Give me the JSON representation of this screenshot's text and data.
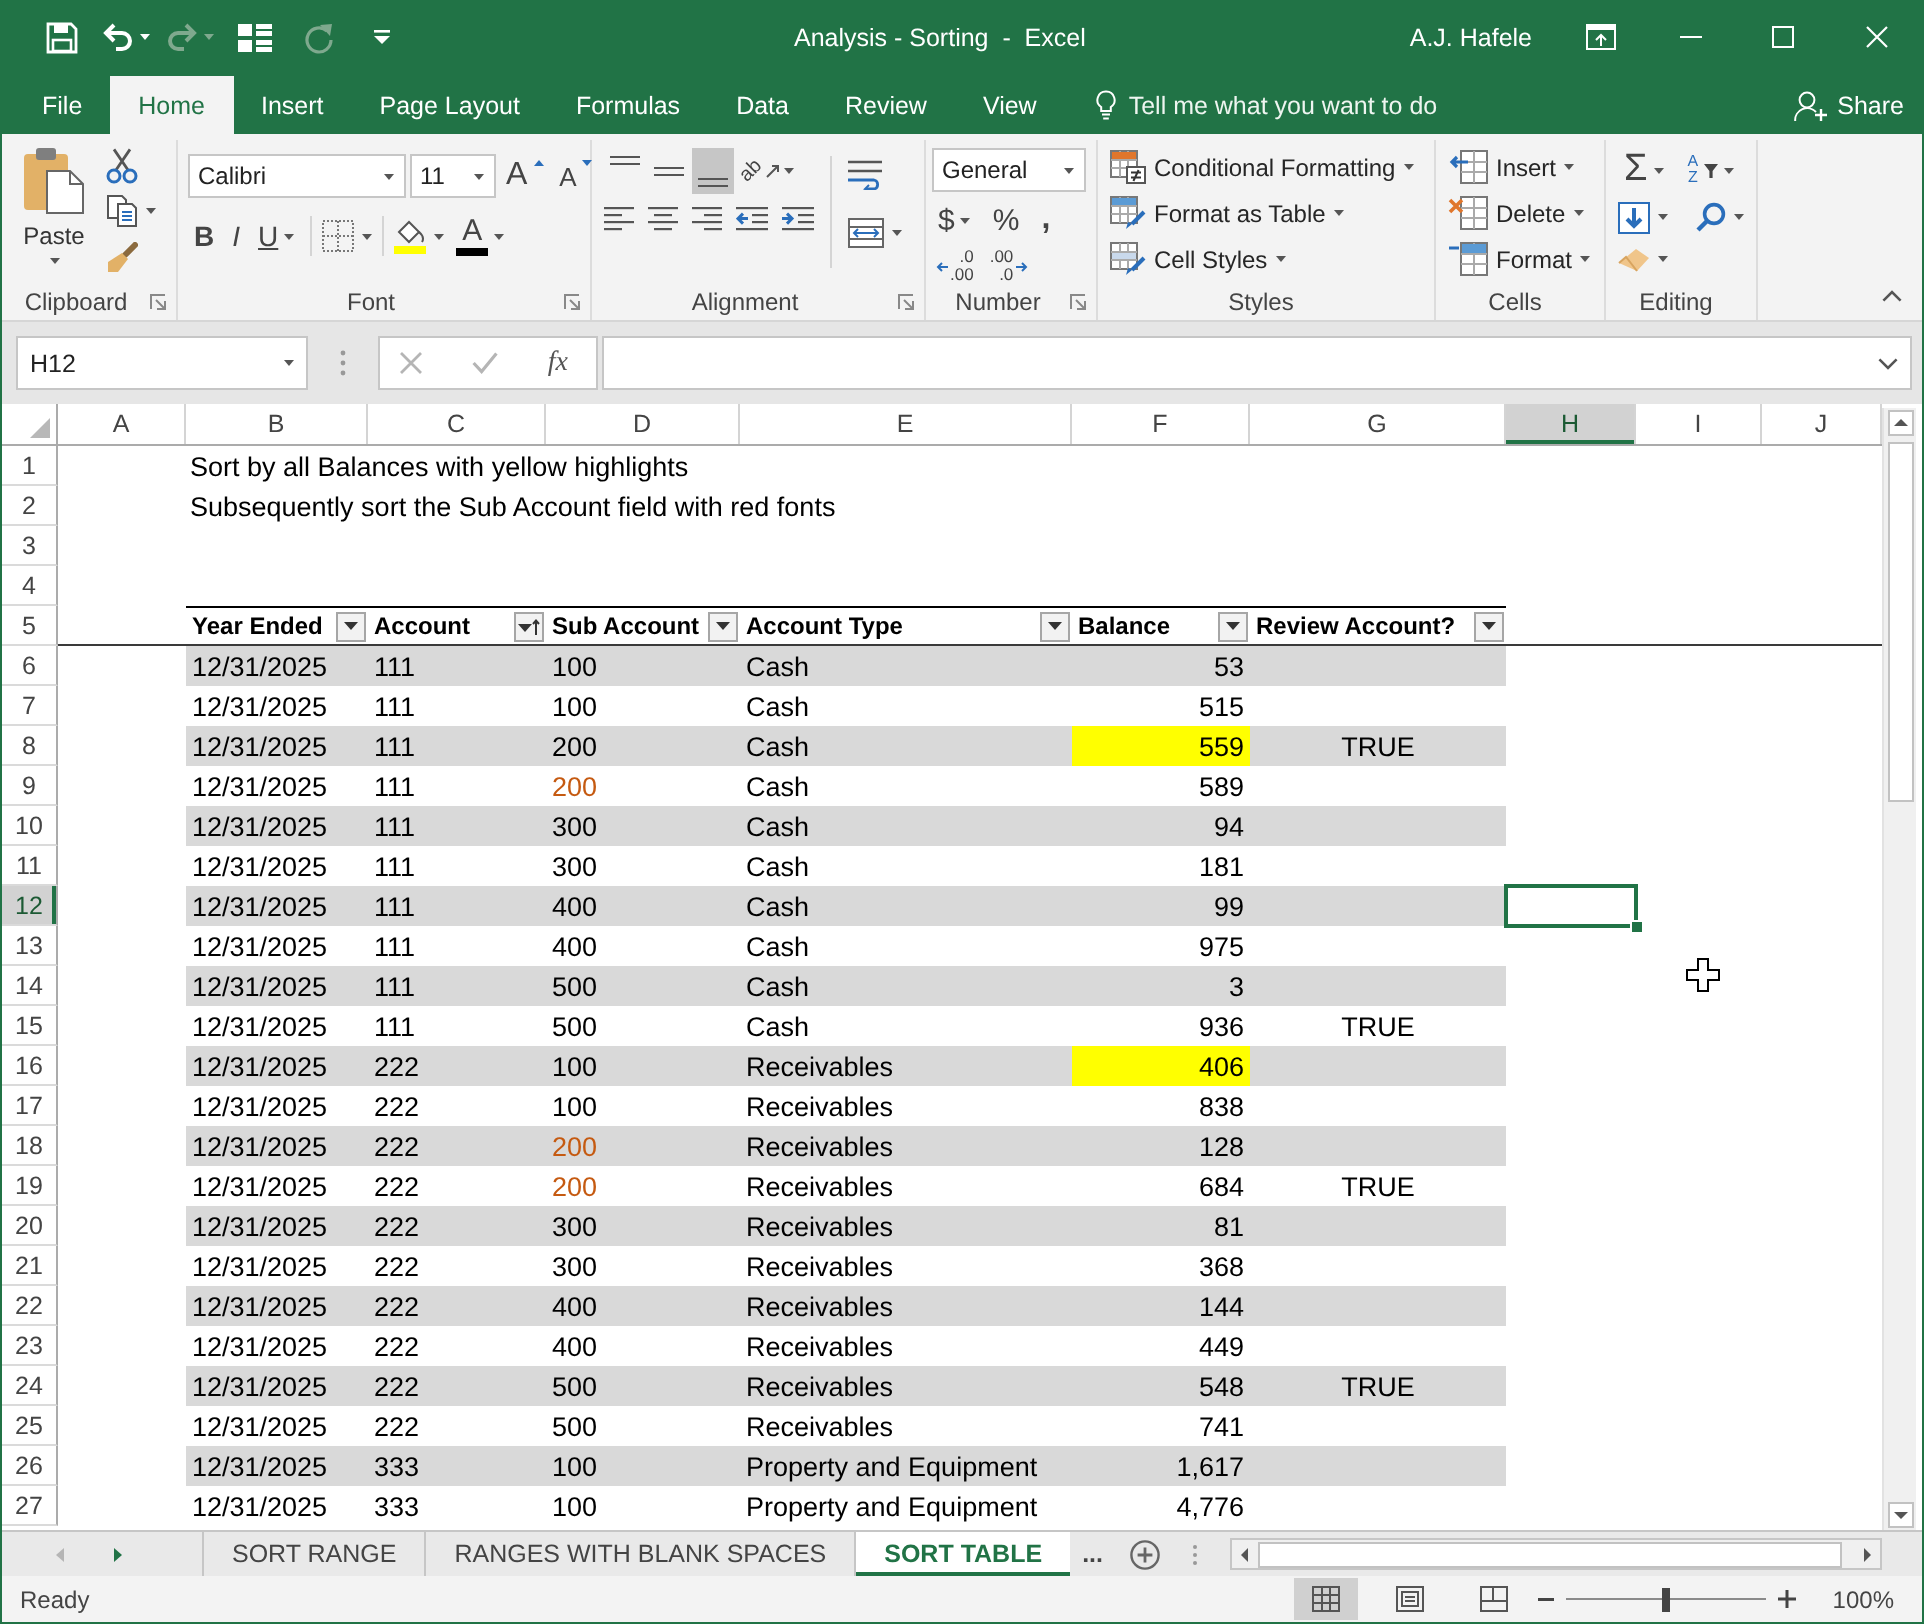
{
  "window": {
    "title": "Analysis - Sorting  -  Excel",
    "user": "A.J. Hafele"
  },
  "quick_access": [
    {
      "kind": "save",
      "disabled": false
    },
    {
      "kind": "undo",
      "disabled": false
    },
    {
      "kind": "redo",
      "disabled": true
    },
    {
      "kind": "form",
      "disabled": false
    },
    {
      "kind": "refresh",
      "disabled": true
    },
    {
      "kind": "customize",
      "disabled": false
    }
  ],
  "ribbon_tabs": [
    {
      "label": "File",
      "selected": false
    },
    {
      "label": "Home",
      "selected": true
    },
    {
      "label": "Insert",
      "selected": false
    },
    {
      "label": "Page Layout",
      "selected": false
    },
    {
      "label": "Formulas",
      "selected": false
    },
    {
      "label": "Data",
      "selected": false
    },
    {
      "label": "Review",
      "selected": false
    },
    {
      "label": "View",
      "selected": false
    }
  ],
  "tell_me": {
    "placeholder": "Tell me what you want to do"
  },
  "share": {
    "label": "Share"
  },
  "clipboard": {
    "paste": "Paste",
    "group_label": "Clipboard"
  },
  "font": {
    "name": "Calibri",
    "size": "11",
    "grow": "A",
    "shrink": "A",
    "bold": "B",
    "italic": "I",
    "underline": "U",
    "font_color_letter": "A",
    "group_label": "Font"
  },
  "alignment": {
    "vertical": [
      {
        "kind": "top",
        "selected": false
      },
      {
        "kind": "middle",
        "selected": false
      },
      {
        "kind": "bottom",
        "selected": true
      }
    ],
    "orientation": "ab",
    "horizontal": [
      {
        "kind": "left"
      },
      {
        "kind": "center"
      },
      {
        "kind": "right"
      },
      {
        "kind": "outdent"
      },
      {
        "kind": "indent"
      }
    ],
    "group_label": "Alignment"
  },
  "number": {
    "format": "General",
    "currency": "$",
    "percent": "%",
    "comma": ",",
    "increase_decimal": {
      "top": ".0",
      "bottom": ".00"
    },
    "decrease_decimal": {
      "top": ".00",
      "bottom": ".0"
    },
    "group_label": "Number"
  },
  "styles": {
    "items": [
      {
        "kind": "conditional",
        "label": "Conditional Formatting"
      },
      {
        "kind": "table",
        "label": "Format as Table"
      },
      {
        "kind": "cell",
        "label": "Cell Styles"
      }
    ],
    "group_label": "Styles"
  },
  "cells": {
    "items": [
      {
        "kind": "insert",
        "label": "Insert"
      },
      {
        "kind": "delete",
        "label": "Delete"
      },
      {
        "kind": "format",
        "label": "Format"
      }
    ],
    "group_label": "Cells"
  },
  "editing": {
    "sum": "Σ",
    "sort_letters": [
      "A",
      "Z"
    ],
    "group_label": "Editing"
  },
  "formula_bar": {
    "name_box": "H12",
    "function": "fx"
  },
  "sheet": {
    "columns": [
      {
        "label": "A",
        "selected": false
      },
      {
        "label": "B",
        "selected": false
      },
      {
        "label": "C",
        "selected": false
      },
      {
        "label": "D",
        "selected": false
      },
      {
        "label": "E",
        "selected": false
      },
      {
        "label": "F",
        "selected": false
      },
      {
        "label": "G",
        "selected": false
      },
      {
        "label": "H",
        "selected": true
      },
      {
        "label": "I",
        "selected": false
      },
      {
        "label": "J",
        "selected": false
      }
    ],
    "rows": [
      {
        "number": "1",
        "selected": false,
        "kind": "note",
        "text": "Sort by all Balances with yellow highlights"
      },
      {
        "number": "2",
        "selected": false,
        "kind": "note",
        "text": "Subsequently sort the Sub Account field with red fonts"
      },
      {
        "number": "3",
        "selected": false,
        "kind": "blank"
      },
      {
        "number": "4",
        "selected": false,
        "kind": "blank"
      },
      {
        "number": "5",
        "selected": false,
        "kind": "header",
        "columns": [
          {
            "label": "Year Ended",
            "sorted": false
          },
          {
            "label": "Account",
            "sorted": true
          },
          {
            "label": "Sub Account",
            "sorted": false
          },
          {
            "label": "Account Type",
            "sorted": false
          },
          {
            "label": "Balance",
            "sorted": false
          },
          {
            "label": "Review Account?",
            "sorted": false
          }
        ]
      },
      {
        "number": "6",
        "selected": false,
        "kind": "data",
        "year_ended": "12/31/2025",
        "account": "111",
        "sub_account": "100",
        "sub_account_red": false,
        "account_type": "Cash",
        "balance": "53",
        "balance_highlighted": false
      },
      {
        "number": "7",
        "selected": false,
        "kind": "data",
        "year_ended": "12/31/2025",
        "account": "111",
        "sub_account": "100",
        "sub_account_red": false,
        "account_type": "Cash",
        "balance": "515",
        "balance_highlighted": false
      },
      {
        "number": "8",
        "selected": false,
        "kind": "data",
        "year_ended": "12/31/2025",
        "account": "111",
        "sub_account": "200",
        "sub_account_red": false,
        "account_type": "Cash",
        "balance": "559",
        "balance_highlighted": true,
        "review": "TRUE"
      },
      {
        "number": "9",
        "selected": false,
        "kind": "data",
        "year_ended": "12/31/2025",
        "account": "111",
        "sub_account": "200",
        "sub_account_red": true,
        "account_type": "Cash",
        "balance": "589",
        "balance_highlighted": false
      },
      {
        "number": "10",
        "selected": false,
        "kind": "data",
        "year_ended": "12/31/2025",
        "account": "111",
        "sub_account": "300",
        "sub_account_red": false,
        "account_type": "Cash",
        "balance": "94",
        "balance_highlighted": false
      },
      {
        "number": "11",
        "selected": false,
        "kind": "data",
        "year_ended": "12/31/2025",
        "account": "111",
        "sub_account": "300",
        "sub_account_red": false,
        "account_type": "Cash",
        "balance": "181",
        "balance_highlighted": false
      },
      {
        "number": "12",
        "selected": true,
        "kind": "data",
        "year_ended": "12/31/2025",
        "account": "111",
        "sub_account": "400",
        "sub_account_red": false,
        "account_type": "Cash",
        "balance": "99",
        "balance_highlighted": false
      },
      {
        "number": "13",
        "selected": false,
        "kind": "data",
        "year_ended": "12/31/2025",
        "account": "111",
        "sub_account": "400",
        "sub_account_red": false,
        "account_type": "Cash",
        "balance": "975",
        "balance_highlighted": false
      },
      {
        "number": "14",
        "selected": false,
        "kind": "data",
        "year_ended": "12/31/2025",
        "account": "111",
        "sub_account": "500",
        "sub_account_red": false,
        "account_type": "Cash",
        "balance": "3",
        "balance_highlighted": false
      },
      {
        "number": "15",
        "selected": false,
        "kind": "data",
        "year_ended": "12/31/2025",
        "account": "111",
        "sub_account": "500",
        "sub_account_red": false,
        "account_type": "Cash",
        "balance": "936",
        "balance_highlighted": false,
        "review": "TRUE"
      },
      {
        "number": "16",
        "selected": false,
        "kind": "data",
        "year_ended": "12/31/2025",
        "account": "222",
        "sub_account": "100",
        "sub_account_red": false,
        "account_type": "Receivables",
        "balance": "406",
        "balance_highlighted": true
      },
      {
        "number": "17",
        "selected": false,
        "kind": "data",
        "year_ended": "12/31/2025",
        "account": "222",
        "sub_account": "100",
        "sub_account_red": false,
        "account_type": "Receivables",
        "balance": "838",
        "balance_highlighted": false
      },
      {
        "number": "18",
        "selected": false,
        "kind": "data",
        "year_ended": "12/31/2025",
        "account": "222",
        "sub_account": "200",
        "sub_account_red": true,
        "account_type": "Receivables",
        "balance": "128",
        "balance_highlighted": false
      },
      {
        "number": "19",
        "selected": false,
        "kind": "data",
        "year_ended": "12/31/2025",
        "account": "222",
        "sub_account": "200",
        "sub_account_red": true,
        "account_type": "Receivables",
        "balance": "684",
        "balance_highlighted": false,
        "review": "TRUE"
      },
      {
        "number": "20",
        "selected": false,
        "kind": "data",
        "year_ended": "12/31/2025",
        "account": "222",
        "sub_account": "300",
        "sub_account_red": false,
        "account_type": "Receivables",
        "balance": "81",
        "balance_highlighted": false
      },
      {
        "number": "21",
        "selected": false,
        "kind": "data",
        "year_ended": "12/31/2025",
        "account": "222",
        "sub_account": "300",
        "sub_account_red": false,
        "account_type": "Receivables",
        "balance": "368",
        "balance_highlighted": false
      },
      {
        "number": "22",
        "selected": false,
        "kind": "data",
        "year_ended": "12/31/2025",
        "account": "222",
        "sub_account": "400",
        "sub_account_red": false,
        "account_type": "Receivables",
        "balance": "144",
        "balance_highlighted": false
      },
      {
        "number": "23",
        "selected": false,
        "kind": "data",
        "year_ended": "12/31/2025",
        "account": "222",
        "sub_account": "400",
        "sub_account_red": false,
        "account_type": "Receivables",
        "balance": "449",
        "balance_highlighted": false
      },
      {
        "number": "24",
        "selected": false,
        "kind": "data",
        "year_ended": "12/31/2025",
        "account": "222",
        "sub_account": "500",
        "sub_account_red": false,
        "account_type": "Receivables",
        "balance": "548",
        "balance_highlighted": false,
        "review": "TRUE"
      },
      {
        "number": "25",
        "selected": false,
        "kind": "data",
        "year_ended": "12/31/2025",
        "account": "222",
        "sub_account": "500",
        "sub_account_red": false,
        "account_type": "Receivables",
        "balance": "741",
        "balance_highlighted": false
      },
      {
        "number": "26",
        "selected": false,
        "kind": "data",
        "year_ended": "12/31/2025",
        "account": "333",
        "sub_account": "100",
        "sub_account_red": false,
        "account_type": "Property and Equipment",
        "balance": "1,617",
        "balance_highlighted": false
      },
      {
        "number": "27",
        "selected": false,
        "kind": "data",
        "year_ended": "12/31/2025",
        "account": "333",
        "sub_account": "100",
        "sub_account_red": false,
        "account_type": "Property and Equipment",
        "balance": "4,776",
        "balance_highlighted": false
      }
    ]
  },
  "sheet_tabs": {
    "nav": [
      {
        "kind": "previous",
        "disabled": true
      },
      {
        "kind": "next",
        "disabled": false
      }
    ],
    "tabs": [
      {
        "label": "SORT RANGE",
        "selected": false
      },
      {
        "label": "RANGES WITH BLANK SPACES",
        "selected": false
      },
      {
        "label": "SORT TABLE",
        "selected": true
      }
    ],
    "more": "..."
  },
  "status_bar": {
    "status": "Ready",
    "views": [
      {
        "kind": "normal",
        "selected": true
      },
      {
        "kind": "page_layout",
        "selected": false
      },
      {
        "kind": "page_break",
        "selected": false
      }
    ],
    "zoom": {
      "level": 0.5,
      "reading": "100%"
    }
  }
}
